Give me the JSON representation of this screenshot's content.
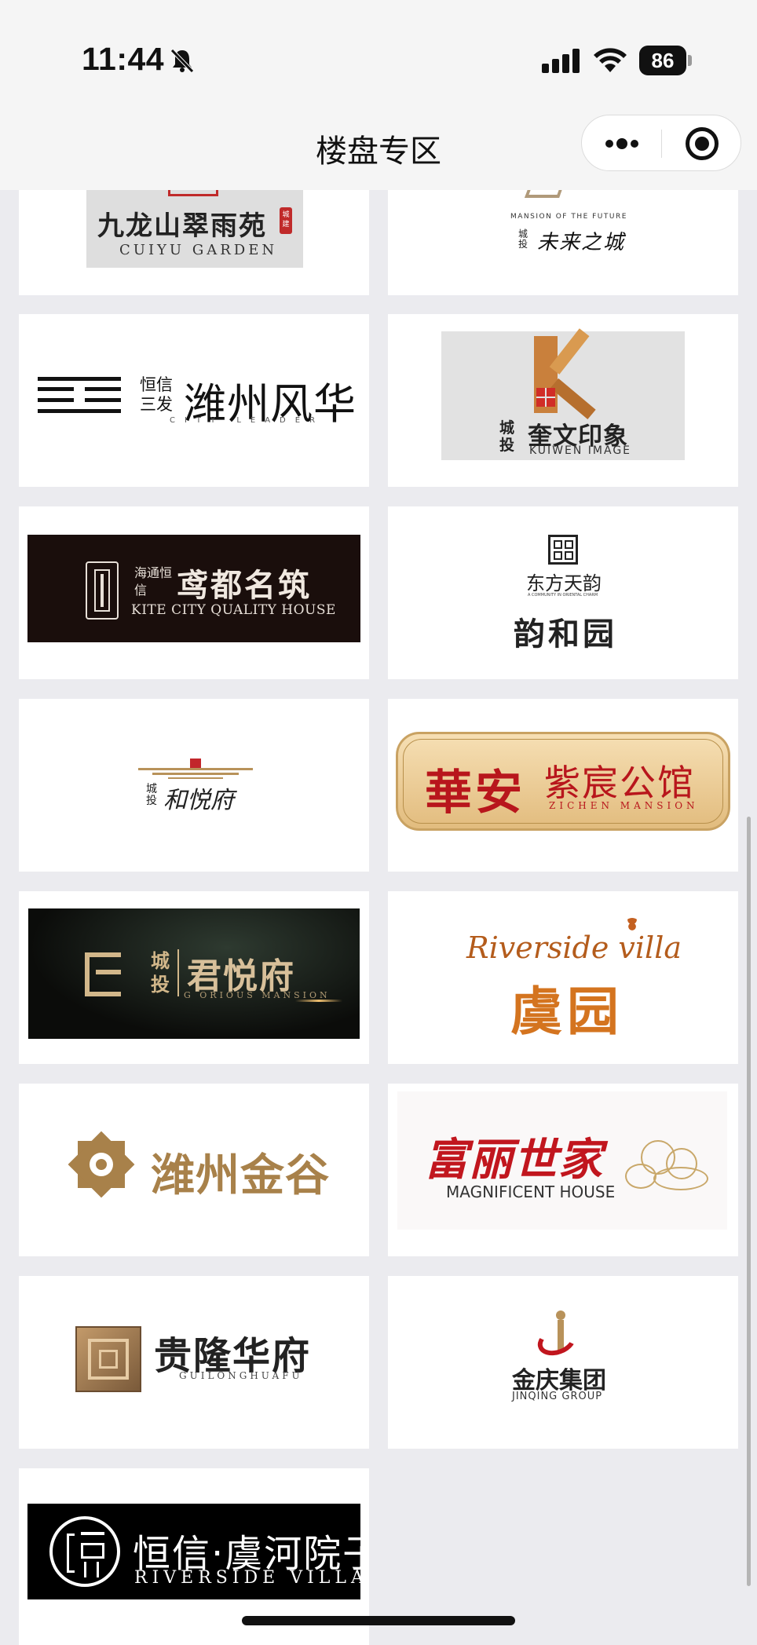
{
  "status_bar": {
    "time": "11:44",
    "battery": "86"
  },
  "nav": {
    "title": "楼盘专区"
  },
  "projects": [
    {
      "cn": "九龙山翠雨苑",
      "en": "CUIYU GARDEN",
      "seal": "城建"
    },
    {
      "top": "MANSION OF THE FUTURE",
      "prefix": "城投",
      "cn": "未来之城"
    },
    {
      "prefix": "恒信三发",
      "cn": "潍州风华",
      "en": "CITY LEADER"
    },
    {
      "prefix": "城投",
      "cn": "奎文印象",
      "en": "KUIWEN IMAGE"
    },
    {
      "prefix": "海通恒信",
      "cn": "鸢都名筑",
      "en": "KITE CITY  QUALITY HOUSE"
    },
    {
      "cn": "东方天韵",
      "tiny": "A COMMUNITY IN ORIENTAL CHARM",
      "sub": "韵和园"
    },
    {
      "prefix": "城投",
      "cn": "和悦府"
    },
    {
      "brand": "華安",
      "cn": "紫宸公馆",
      "en": "ZICHEN MANSION"
    },
    {
      "prefix": "城投",
      "cn": "君悦府",
      "en": "G ORIOUS MANSION"
    },
    {
      "script": "Riverside villa",
      "cn": "虞园"
    },
    {
      "cn": "潍州金谷"
    },
    {
      "cn": "富丽世家",
      "en": "MAGNIFICENT HOUSE"
    },
    {
      "cn": "贵隆华府",
      "en": "GUILONGHUAFU"
    },
    {
      "cn": "金庆集团",
      "en": "JINQING GROUP"
    },
    {
      "cn": "恒信·虞河院子",
      "en": "RIVERSIDE VILLA"
    }
  ],
  "colors": {
    "gold": "#a8814a",
    "red": "#c1161e",
    "brown": "#c26a1c",
    "dark": "#1a1a1a"
  }
}
